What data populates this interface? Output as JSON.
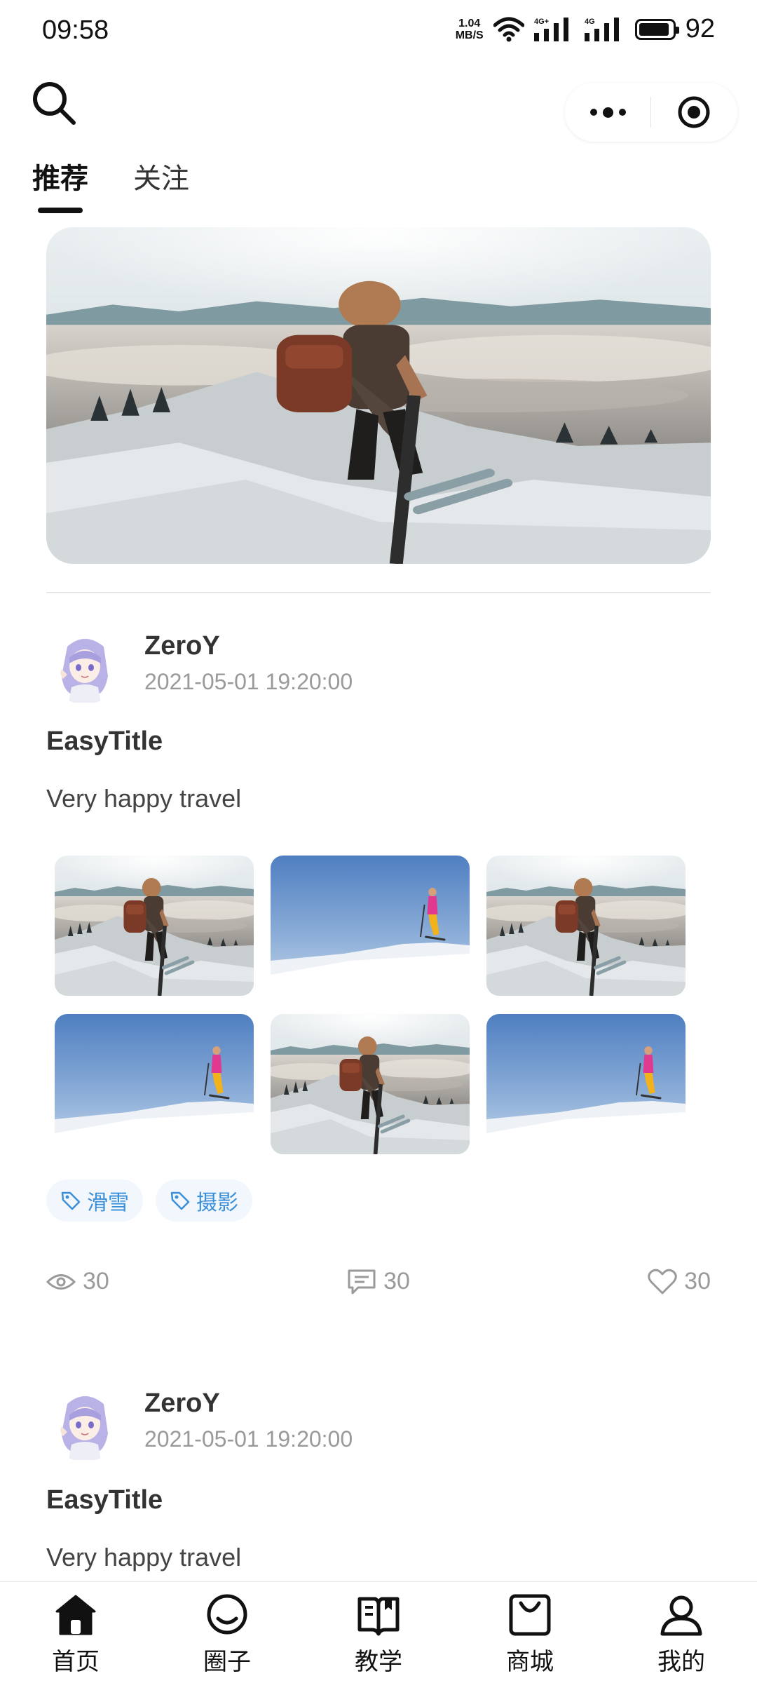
{
  "status_bar": {
    "time": "09:58",
    "net_speed_value": "1.04",
    "net_speed_unit": "MB/S",
    "signal1_label": "4G+",
    "signal2_label": "4G",
    "battery_level": "92",
    "battery_fraction": 0.92
  },
  "header": {
    "search_icon": "search-icon",
    "tabs": [
      {
        "label": "推荐",
        "active": true
      },
      {
        "label": "关注",
        "active": false
      }
    ]
  },
  "posts": [
    {
      "author": "ZeroY",
      "time": "2021-05-01 19:20:00",
      "title": "EasyTitle",
      "description": "Very happy travel",
      "images": [
        "hiker-clouds",
        "skier-blue-sky",
        "hiker-clouds",
        "skier-blue-sky",
        "hiker-clouds",
        "skier-blue-sky"
      ],
      "tags": [
        "滑雪",
        "摄影"
      ],
      "stats": {
        "views": "30",
        "comments": "30",
        "likes": "30"
      }
    },
    {
      "author": "ZeroY",
      "time": "2021-05-01 19:20:00",
      "title": "EasyTitle",
      "description": "Very happy travel"
    }
  ],
  "bottom_nav": [
    {
      "label": "首页",
      "icon": "home-icon"
    },
    {
      "label": "圈子",
      "icon": "chat-bubble-icon"
    },
    {
      "label": "教学",
      "icon": "book-icon"
    },
    {
      "label": "商城",
      "icon": "shopping-bag-icon"
    },
    {
      "label": "我的",
      "icon": "user-icon"
    }
  ],
  "colors": {
    "accent": "#3b8fd8",
    "tag_bg": "#f1f7fd",
    "text_muted": "#9a9a9a"
  }
}
